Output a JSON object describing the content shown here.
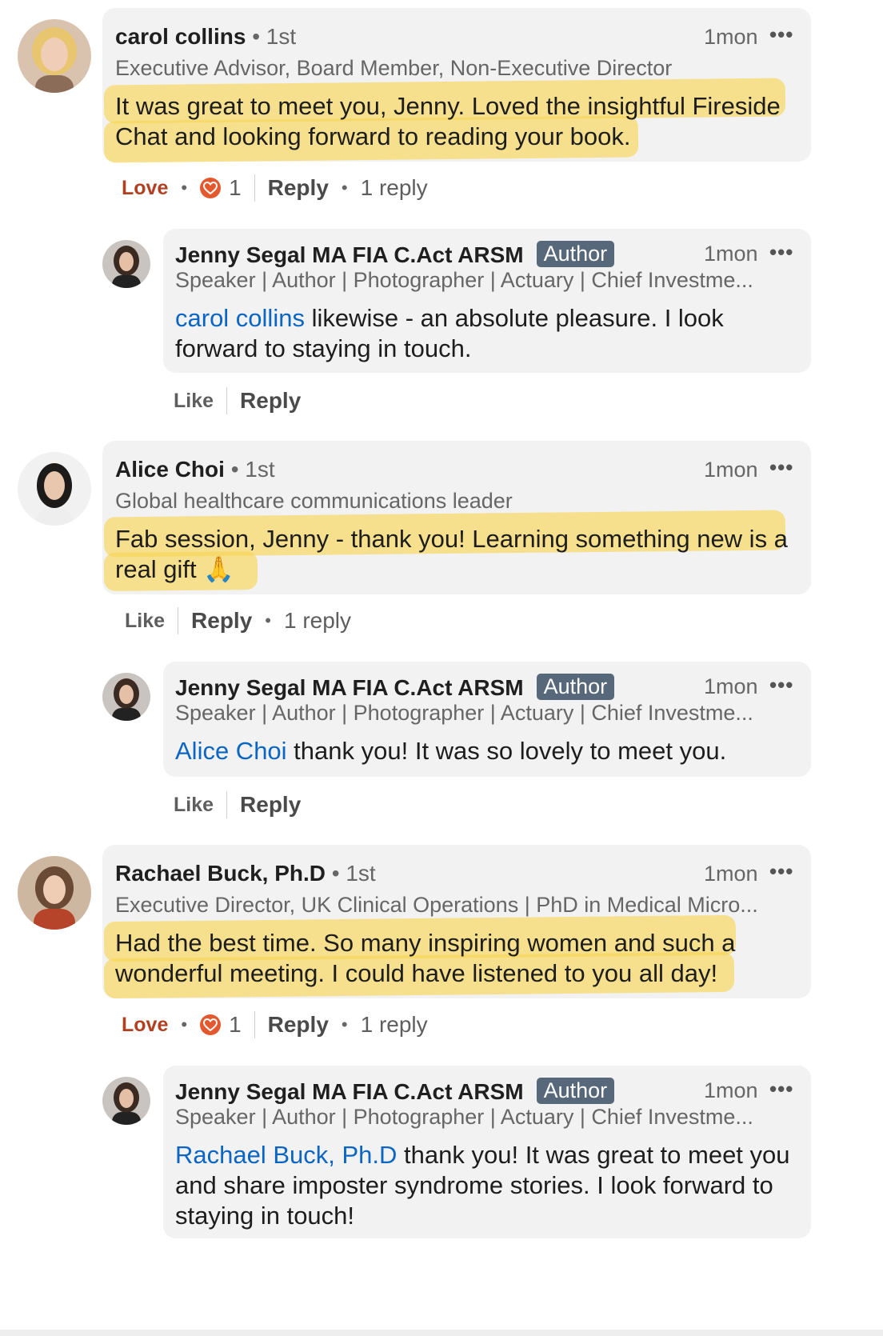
{
  "comments": [
    {
      "name": "carol collins",
      "degree": "• 1st",
      "time": "1mon",
      "more": "•••",
      "headline": "Executive Advisor, Board Member, Non-Executive Director",
      "text_line1": "It was great to meet you, Jenny. Loved the insightful Fireside",
      "text_line2": "Chat and looking forward to reading your book.",
      "reaction_label": "Love",
      "reaction_count": "1",
      "reply_label": "Reply",
      "replies_count": "1 reply",
      "reply": {
        "name": "Jenny Segal MA FIA C.Act ARSM",
        "badge": "Author",
        "time": "1mon",
        "more": "•••",
        "headline": "Speaker | Author | Photographer | Actuary | Chief Investme...",
        "mention": "carol collins",
        "text_line1": " likewise - an absolute pleasure.  I look",
        "text_line2": "forward to staying in touch.",
        "like_label": "Like",
        "reply_label": "Reply"
      }
    },
    {
      "name": "Alice Choi",
      "degree": "• 1st",
      "time": "1mon",
      "more": "•••",
      "headline": "Global healthcare communications leader",
      "text_line1": "Fab session, Jenny - thank you! Learning something new is a",
      "text_line2": "real gift 🙏",
      "like_label": "Like",
      "reply_label": "Reply",
      "replies_count": "1 reply",
      "reply": {
        "name": "Jenny Segal MA FIA C.Act ARSM",
        "badge": "Author",
        "time": "1mon",
        "more": "•••",
        "headline": "Speaker | Author | Photographer | Actuary | Chief Investme...",
        "mention": "Alice Choi",
        "text_line1": " thank you!  It was so lovely to meet you.",
        "like_label": "Like",
        "reply_label": "Reply"
      }
    },
    {
      "name": "Rachael Buck, Ph.D",
      "degree": "• 1st",
      "time": "1mon",
      "more": "•••",
      "headline": "Executive Director, UK Clinical Operations | PhD in Medical Micro...",
      "text_line1": "Had the best time. So many inspiring women and such a",
      "text_line2": "wonderful meeting.  I could have listened to you all day!",
      "reaction_label": "Love",
      "reaction_count": "1",
      "reply_label": "Reply",
      "replies_count": "1 reply",
      "reply": {
        "name": "Jenny Segal MA FIA C.Act ARSM",
        "badge": "Author",
        "time": "1mon",
        "more": "•••",
        "headline": "Speaker | Author | Photographer | Actuary | Chief Investme...",
        "mention": "Rachael Buck, Ph.D",
        "text_line1": " thank you!  It was great to meet you",
        "text_line2": "and share imposter syndrome stories.  I look forward to",
        "text_line3": "staying in touch!"
      }
    }
  ],
  "colors": {
    "highlight": "#f8d658",
    "mention": "#0a66c2",
    "love": "#b24020",
    "author_badge": "#56687a",
    "bubble": "#f2f2f2"
  }
}
